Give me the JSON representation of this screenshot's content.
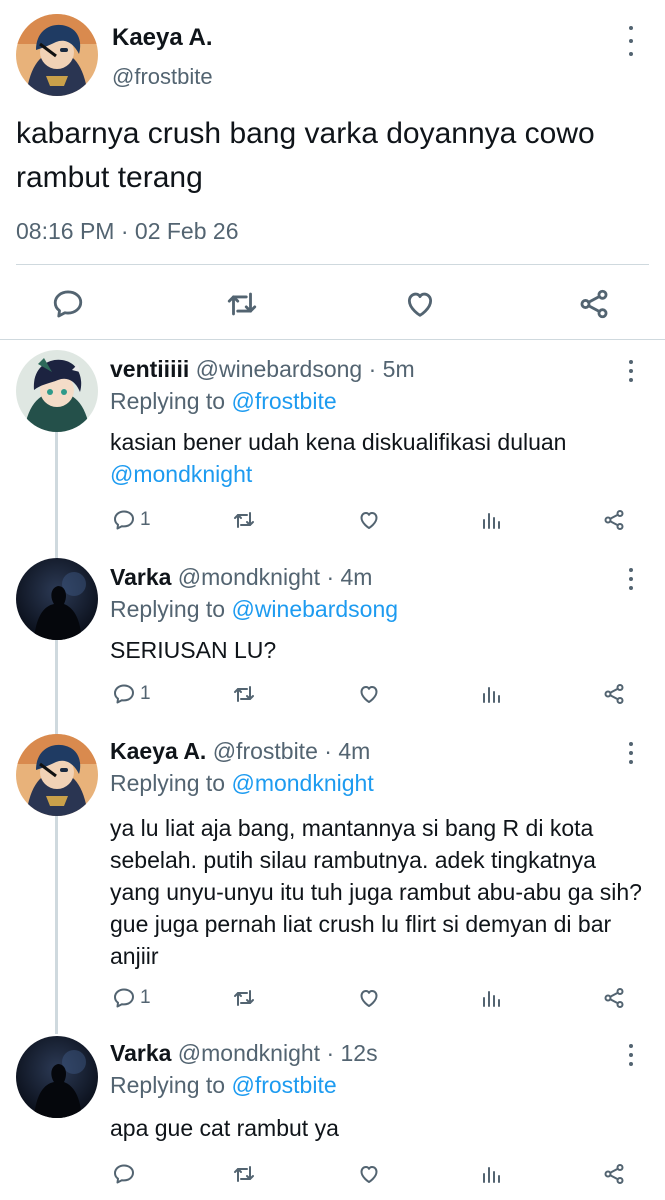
{
  "main_tweet": {
    "name": "Kaeya A.",
    "handle": "@frostbite",
    "text": "kabarnya crush bang varka doyannya cowo rambut terang",
    "time": "08:16 PM",
    "separator": "·",
    "date": "02 Feb 26"
  },
  "colors": {
    "text": "#0f1419",
    "secondary": "#536471",
    "link": "#1d9bf0",
    "divider": "#cfd9de"
  },
  "replies": [
    {
      "name": "ventiiiii",
      "handle": "@winebardsong",
      "separator": "·",
      "time": "5m",
      "replying_prefix": "Replying to",
      "replying_to": "@frostbite",
      "text": "kasian bener udah kena diskualifikasi duluan",
      "mention": "@mondknight",
      "reply_count": "1"
    },
    {
      "name": "Varka",
      "handle": "@mondknight",
      "separator": "·",
      "time": "4m",
      "replying_prefix": "Replying to",
      "replying_to": "@winebardsong",
      "text": "SERIUSAN LU?",
      "reply_count": "1"
    },
    {
      "name": "Kaeya A.",
      "handle": "@frostbite",
      "separator": "·",
      "time": "4m",
      "replying_prefix": "Replying to",
      "replying_to": "@mondknight",
      "text": "ya lu liat aja bang, mantannya si bang R di kota sebelah. putih silau rambutnya. adek tingkatnya yang unyu-unyu itu tuh juga rambut abu-abu ga sih? gue juga pernah liat crush lu flirt si demyan di bar anjiir",
      "reply_count": "1"
    },
    {
      "name": "Varka",
      "handle": "@mondknight",
      "separator": "·",
      "time": "12s",
      "replying_prefix": "Replying to",
      "replying_to": "@frostbite",
      "text": "apa gue cat rambut ya",
      "reply_count": ""
    }
  ],
  "icons": {
    "reply": "reply-icon",
    "retweet": "retweet-icon",
    "like": "like-icon",
    "views": "views-icon",
    "share": "share-icon",
    "more": "more-icon"
  }
}
